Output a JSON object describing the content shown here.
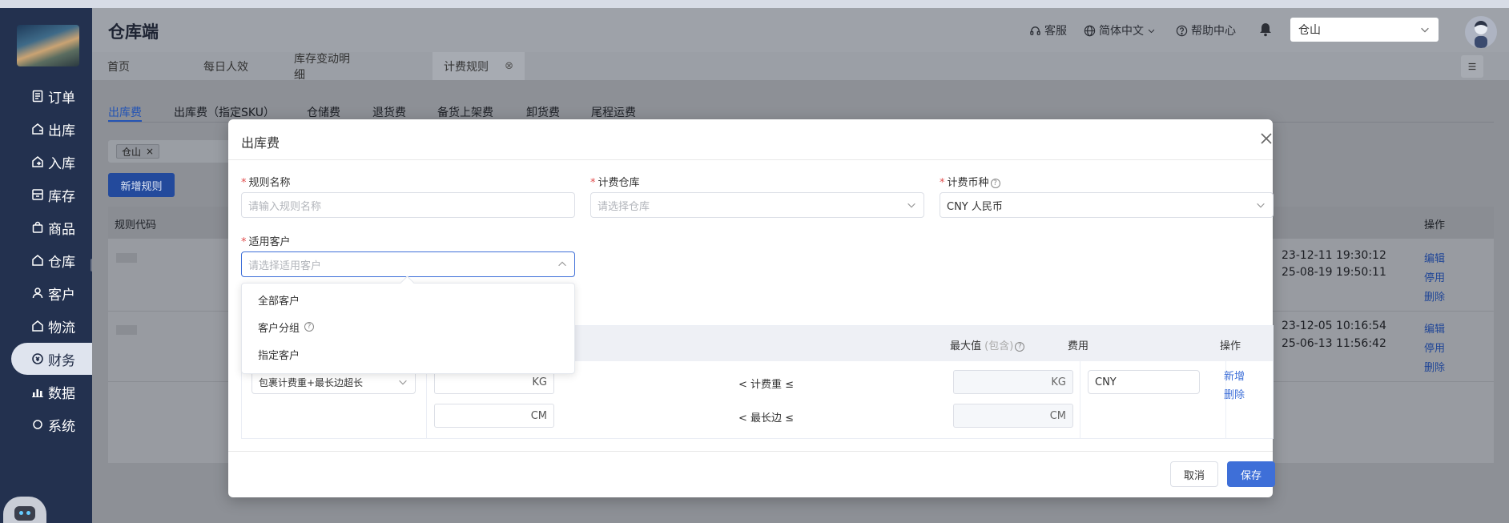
{
  "app": {
    "title": "仓库端"
  },
  "header": {
    "service": "客服",
    "language": "简体中文",
    "help_center": "帮助中心",
    "warehouse_value": "仓山"
  },
  "sidebar": {
    "items": [
      {
        "label": "订单",
        "icon": "list-icon"
      },
      {
        "label": "出库",
        "icon": "outbound-icon"
      },
      {
        "label": "入库",
        "icon": "inbound-icon"
      },
      {
        "label": "库存",
        "icon": "inventory-icon"
      },
      {
        "label": "商品",
        "icon": "bag-icon"
      },
      {
        "label": "仓库",
        "icon": "warehouse-icon"
      },
      {
        "label": "客户",
        "icon": "user-icon"
      },
      {
        "label": "物流",
        "icon": "logistics-icon"
      },
      {
        "label": "财务",
        "icon": "finance-icon",
        "active": true
      },
      {
        "label": "数据",
        "icon": "chart-icon"
      },
      {
        "label": "系统",
        "icon": "system-icon"
      }
    ]
  },
  "page_tabs": [
    {
      "label": "首页"
    },
    {
      "label": "每日人效"
    },
    {
      "label": "库存变动明细"
    },
    {
      "label": "计费规则",
      "active": true,
      "close": "⊗"
    }
  ],
  "sub_tabs": [
    "出库费",
    "出库费（指定SKU）",
    "仓储费",
    "退货费",
    "备货上架费",
    "卸货费",
    "尾程运费"
  ],
  "filter": {
    "chip": "仓山"
  },
  "buttons": {
    "new_rule": "新增规则"
  },
  "bg_table": {
    "headers": {
      "code": "规则代码",
      "action": "操作"
    },
    "rows": [
      {
        "times": [
          "23-12-11 19:30:12",
          "25-08-19 19:50:11"
        ],
        "actions": [
          "编辑",
          "停用",
          "删除"
        ]
      },
      {
        "times": [
          "23-12-05 10:16:54",
          "25-06-13 11:56:42"
        ],
        "actions": [
          "编辑",
          "停用",
          "删除"
        ]
      }
    ]
  },
  "modal": {
    "title": "出库费",
    "rule_name": {
      "label": "规则名称",
      "placeholder": "请输入规则名称"
    },
    "warehouse": {
      "label": "计费仓库",
      "placeholder": "请选择仓库"
    },
    "currency": {
      "label": "计费币种",
      "value": "CNY 人民币"
    },
    "customer": {
      "label": "适用客户",
      "placeholder": "请选择适用客户"
    },
    "customer_options": [
      "全部客户",
      "客户分组",
      "指定客户"
    ],
    "fee_table": {
      "headers": {
        "max_label": "最大值",
        "max_hint": "(包含)",
        "fee": "费用",
        "action": "操作"
      },
      "calc_method": "包裹计费重+最长边超长",
      "rows": [
        {
          "min_unit": "KG",
          "condition": "< 计费重 ≤",
          "max_unit": "KG"
        },
        {
          "min_unit": "CM",
          "condition": "< 最长边 ≤",
          "max_unit": "CM"
        }
      ],
      "currency": "CNY",
      "add": "新增",
      "delete": "删除"
    },
    "cancel": "取消",
    "save": "保存"
  },
  "colors": {
    "primary": "#3e6fd8",
    "sidebar_bg": "#23314f",
    "required": "#e14c4c"
  }
}
